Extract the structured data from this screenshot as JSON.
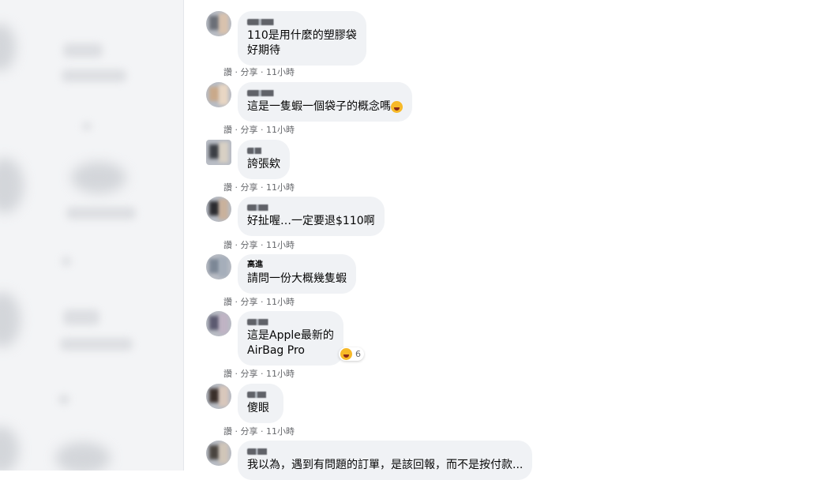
{
  "comments": [
    {
      "author": "",
      "lines": [
        "110是用什麼的塑膠袋",
        "好期待"
      ],
      "like": "讚",
      "reply": "分享",
      "time": "11小時"
    },
    {
      "author": "",
      "lines": [
        "這是一隻蝦一個袋子的概念嗎"
      ],
      "like": "讚",
      "reply": "分享",
      "time": "11小時",
      "emoji_icon": "laugh-emoji-icon"
    },
    {
      "author": "",
      "lines": [
        "誇張欸"
      ],
      "like": "讚",
      "reply": "分享",
      "time": "11小時"
    },
    {
      "author": "",
      "lines": [
        "好扯喔…一定要退$110啊"
      ],
      "like": "讚",
      "reply": "分享",
      "time": "11小時"
    },
    {
      "author": "高進",
      "lines": [
        "請問一份大概幾隻蝦"
      ],
      "like": "讚",
      "reply": "分享",
      "time": "11小時"
    },
    {
      "author": "",
      "lines": [
        "這是Apple最新的",
        "AirBag Pro"
      ],
      "like": "讚",
      "reply": "分享",
      "time": "11小時",
      "reactions": {
        "icon": "haha-reaction-icon",
        "count": "6"
      }
    },
    {
      "author": "",
      "lines": [
        "傻眼"
      ],
      "like": "讚",
      "reply": "分享",
      "time": "11小時"
    },
    {
      "author": "",
      "lines": [
        "我以為，遇到有問題的訂單，是該回報，而不是按付款..."
      ],
      "like": "",
      "reply": "",
      "time": ""
    }
  ],
  "sep": "·",
  "colors": {
    "bubble": "#f0f2f5",
    "meta": "#65676b",
    "text": "#050505"
  }
}
